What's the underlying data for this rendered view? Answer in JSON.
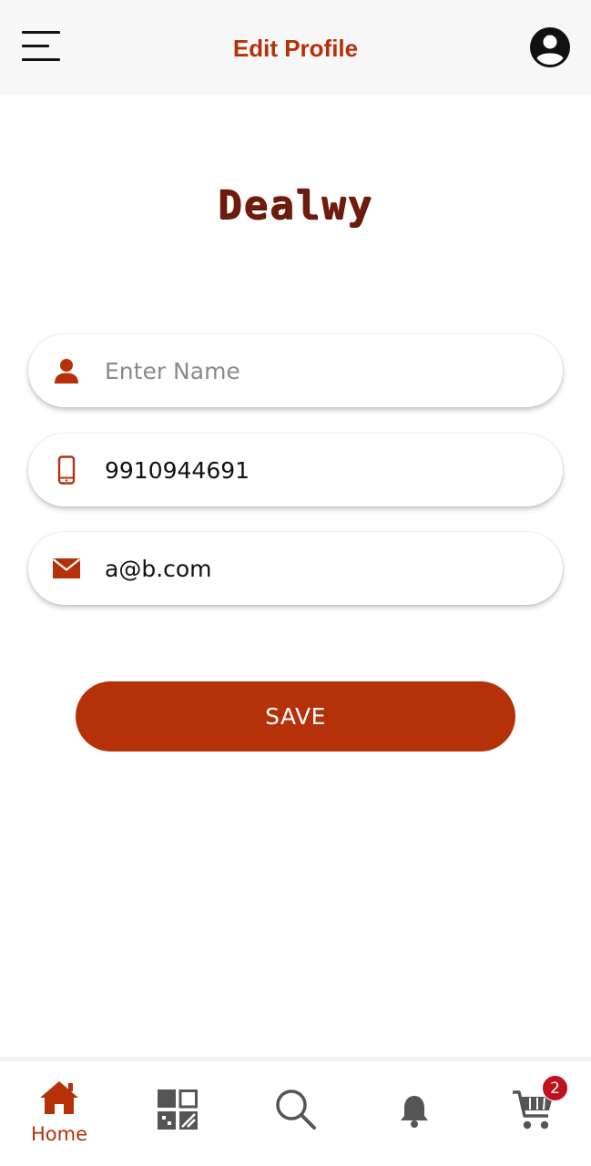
{
  "header": {
    "title": "Edit Profile"
  },
  "logo": {
    "text": "Dealwy"
  },
  "form": {
    "name": {
      "value": "",
      "placeholder": "Enter Name"
    },
    "phone": {
      "value": "9910944691",
      "placeholder": ""
    },
    "email": {
      "value": "a@b.com",
      "placeholder": ""
    },
    "save_label": "SAVE"
  },
  "bottom_nav": {
    "home_label": "Home",
    "cart_count": "2"
  },
  "colors": {
    "accent": "#b5310a",
    "badge": "#c1101e",
    "icon_gray": "#555555"
  }
}
